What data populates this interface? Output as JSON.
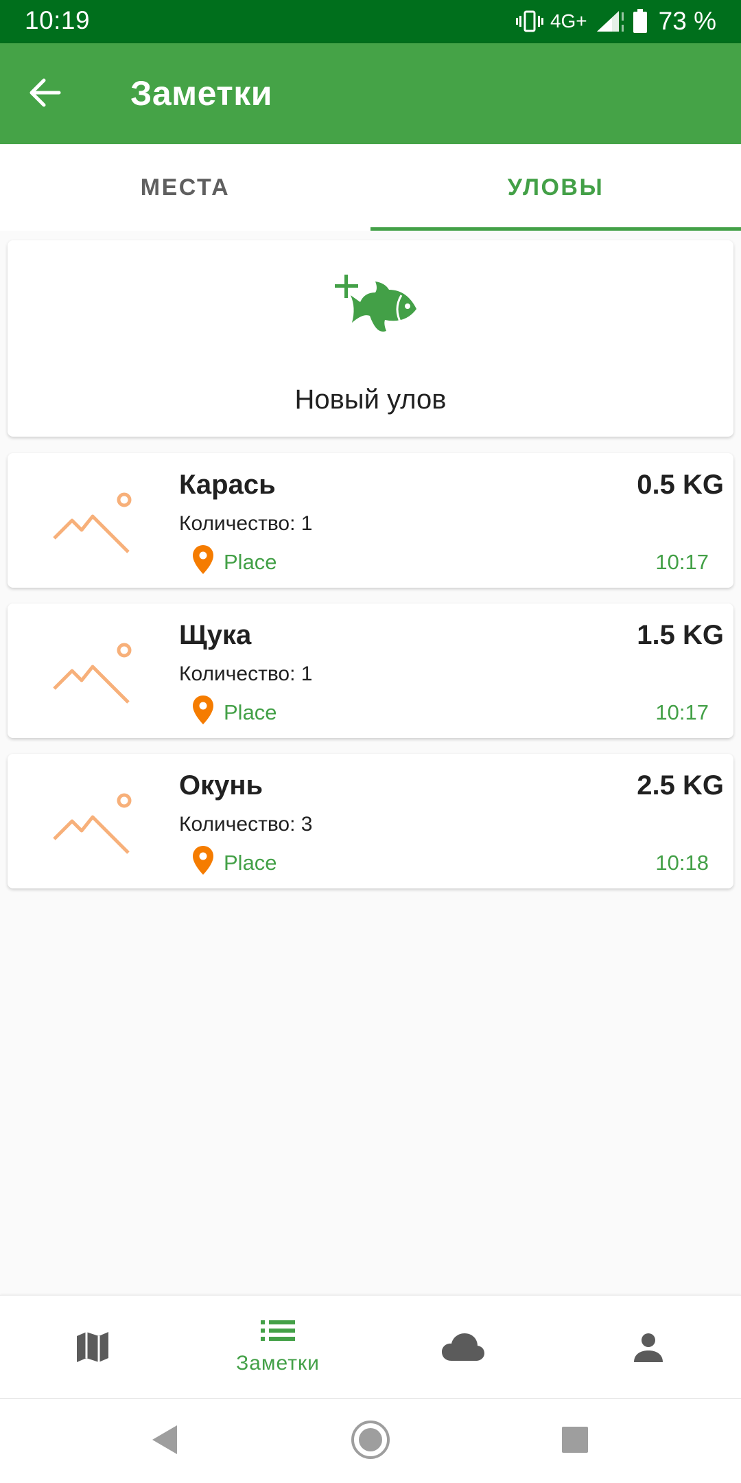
{
  "status_bar": {
    "time": "10:19",
    "network": "4G+",
    "battery": "73 %"
  },
  "app_bar": {
    "title": "Заметки",
    "back_icon": "arrow-left-icon"
  },
  "tabs": [
    {
      "label": "МЕСТА",
      "active": false
    },
    {
      "label": "УЛОВЫ",
      "active": true
    }
  ],
  "new_catch": {
    "label": "Новый улов",
    "icon": "add-fish-icon"
  },
  "catches": [
    {
      "name": "Карась",
      "weight": "0.5 KG",
      "quantity": "Количество: 1",
      "place": "Place",
      "time": "10:17"
    },
    {
      "name": "Щука",
      "weight": "1.5 KG",
      "quantity": "Количество: 1",
      "place": "Place",
      "time": "10:17"
    },
    {
      "name": "Окунь",
      "weight": "2.5 KG",
      "quantity": "Количество: 3",
      "place": "Place",
      "time": "10:18"
    }
  ],
  "bottom_nav": [
    {
      "icon": "map-icon",
      "label": ""
    },
    {
      "icon": "notes-list-icon",
      "label": "Заметки",
      "active": true
    },
    {
      "icon": "cloud-icon",
      "label": ""
    },
    {
      "icon": "person-icon",
      "label": ""
    }
  ],
  "colors": {
    "status_bar": "#006f1c",
    "app_bar": "#45a347",
    "accent": "#43a047",
    "pin": "#f57c00",
    "thumb": "#f7b07a"
  }
}
